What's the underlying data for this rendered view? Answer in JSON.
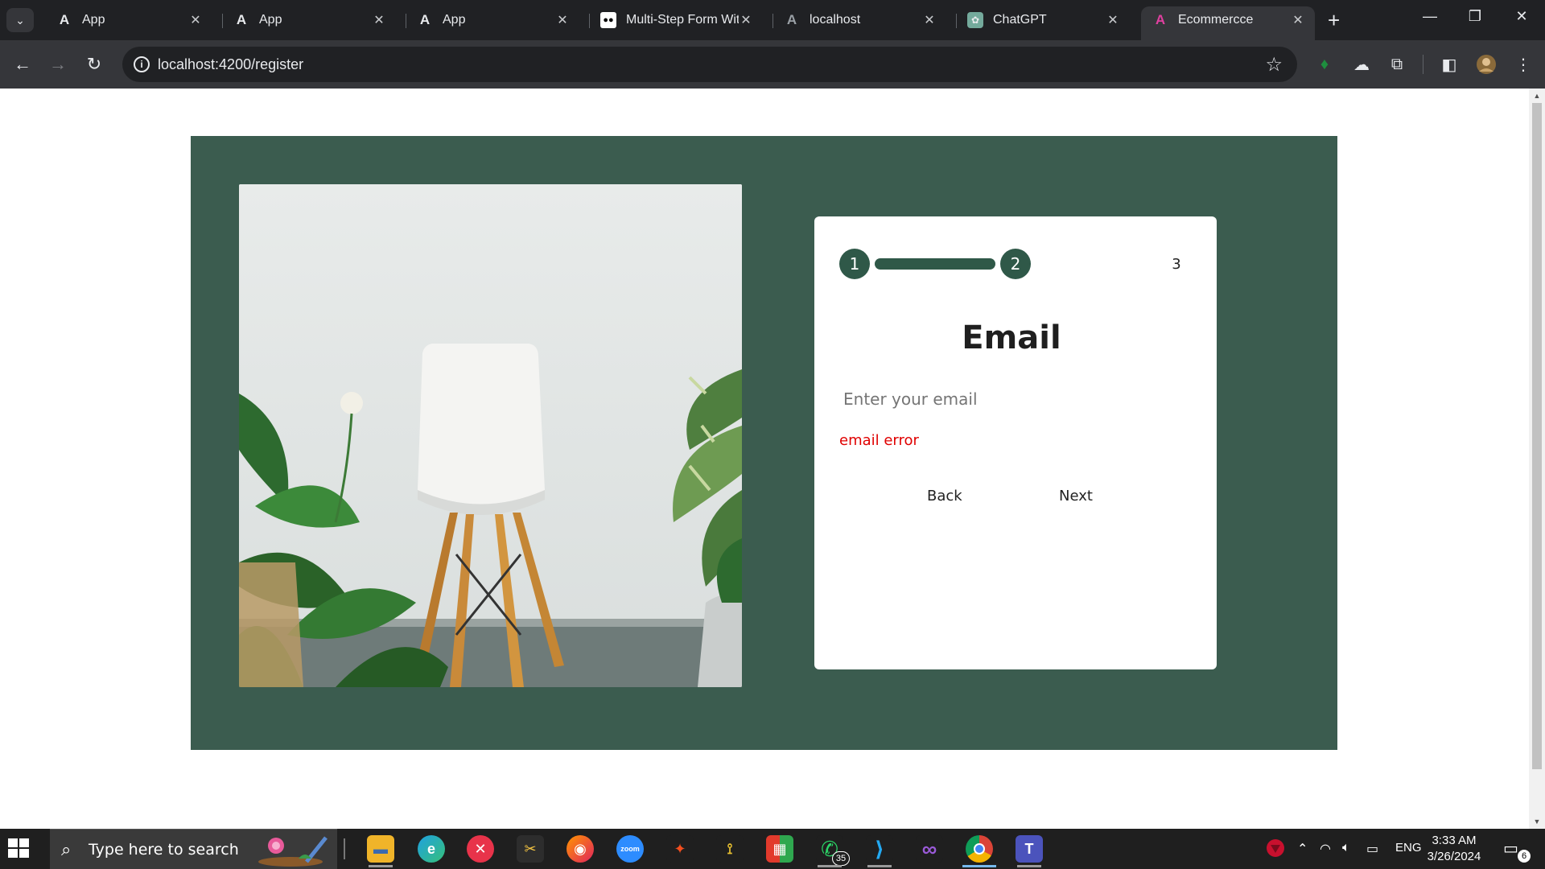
{
  "browser": {
    "tabs": [
      {
        "title": "App",
        "favicon": "angular-icon"
      },
      {
        "title": "App",
        "favicon": "angular-icon"
      },
      {
        "title": "App",
        "favicon": "angular-icon"
      },
      {
        "title": "Multi-Step Form With",
        "favicon": "medium-icon"
      },
      {
        "title": "localhost",
        "favicon": "angular-gray-icon"
      },
      {
        "title": "ChatGPT",
        "favicon": "chatgpt-icon"
      },
      {
        "title": "Ecommercce",
        "favicon": "angular-pink-icon",
        "active": true
      }
    ],
    "url": "localhost:4200/register"
  },
  "form": {
    "steps": [
      "1",
      "2",
      "3"
    ],
    "current_step": 2,
    "title": "Email",
    "email_placeholder": "Enter your email",
    "email_value": "",
    "error": "email error",
    "back_label": "Back",
    "next_label": "Next"
  },
  "colors": {
    "panel": "#3b5c4f",
    "step_active": "#2f5848",
    "error": "#e00000"
  },
  "taskbar": {
    "search_placeholder": "Type here to search",
    "whatsapp_badge": "35",
    "language": "ENG",
    "time": "3:33 AM",
    "date": "3/26/2024",
    "notification_count": "6",
    "apps": [
      "file-explorer-icon",
      "edge-icon",
      "xmind-icon",
      "snipping-tool-icon",
      "firefox-icon",
      "zoom-icon",
      "figma-icon",
      "git-tool-icon",
      "office-icon",
      "whatsapp-icon",
      "vscode-icon",
      "visual-studio-icon",
      "chrome-icon",
      "teams-icon"
    ]
  }
}
